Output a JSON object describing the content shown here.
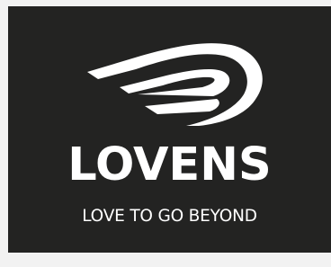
{
  "logo": {
    "brand_name": "LOVENS",
    "tagline": "LOVE TO GO BEYOND",
    "mark": "wing-icon",
    "colors": {
      "background": "#232322",
      "foreground": "#ffffff",
      "page": "#f2f2f2"
    }
  }
}
